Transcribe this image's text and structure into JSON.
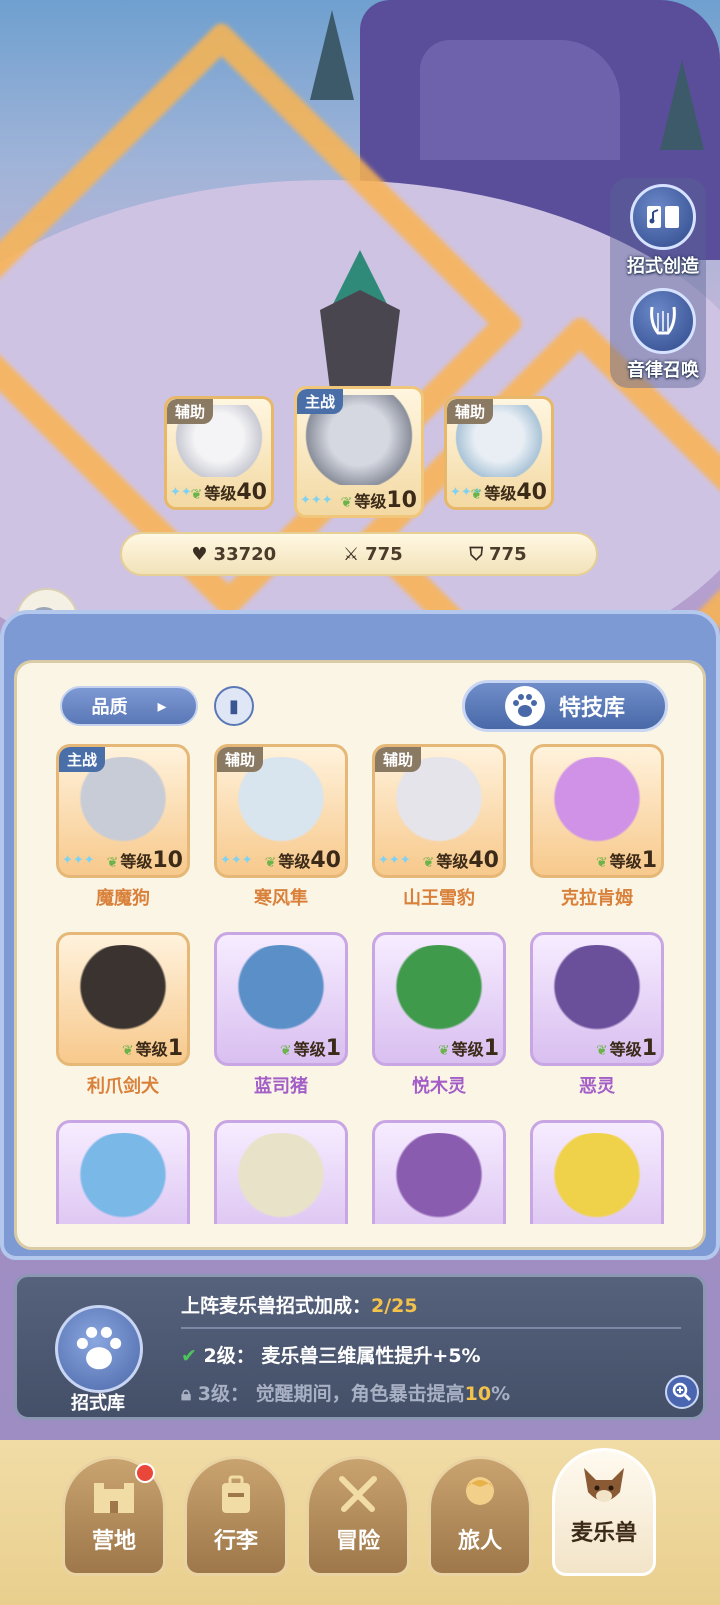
{
  "side_buttons": [
    {
      "label": "招式创造",
      "icon": "music-book-icon"
    },
    {
      "label": "音律召唤",
      "icon": "lyre-icon"
    }
  ],
  "team": [
    {
      "tag": "辅助",
      "level_label": "等级",
      "level": "40"
    },
    {
      "tag": "主战",
      "level_label": "等级",
      "level": "10"
    },
    {
      "tag": "辅助",
      "level_label": "等级",
      "level": "40"
    }
  ],
  "stats": {
    "hp": "33720",
    "attack": "775",
    "defense": "775"
  },
  "panel": {
    "filter_label": "品质",
    "skill_library_label": "特技库"
  },
  "pets": [
    {
      "name": "魔魔狗",
      "tag": "主战",
      "level_label": "等级",
      "level": "10",
      "rarity": "orange",
      "color": "#c8ccd6"
    },
    {
      "name": "寒风隼",
      "tag": "辅助",
      "level_label": "等级",
      "level": "40",
      "rarity": "orange",
      "color": "#d8e4ee"
    },
    {
      "name": "山王雪豹",
      "tag": "辅助",
      "level_label": "等级",
      "level": "40",
      "rarity": "orange",
      "color": "#e4e4ea"
    },
    {
      "name": "克拉肯姆",
      "tag": "",
      "level_label": "等级",
      "level": "1",
      "rarity": "orange",
      "color": "#cf92e6"
    },
    {
      "name": "利爪剑犬",
      "tag": "",
      "level_label": "等级",
      "level": "1",
      "rarity": "orange",
      "color": "#3a3330"
    },
    {
      "name": "蓝司猪",
      "tag": "",
      "level_label": "等级",
      "level": "1",
      "rarity": "purple",
      "color": "#5a8fc8"
    },
    {
      "name": "悦木灵",
      "tag": "",
      "level_label": "等级",
      "level": "1",
      "rarity": "purple",
      "color": "#3f9a4c"
    },
    {
      "name": "恶灵",
      "tag": "",
      "level_label": "等级",
      "level": "1",
      "rarity": "purple",
      "color": "#6a4f9a"
    },
    {
      "name": "",
      "tag": "",
      "level_label": "",
      "level": "",
      "rarity": "purple",
      "color": "#7ab8e8"
    },
    {
      "name": "",
      "tag": "",
      "level_label": "",
      "level": "",
      "rarity": "purple",
      "color": "#e8e2c8"
    },
    {
      "name": "",
      "tag": "",
      "level_label": "",
      "level": "",
      "rarity": "purple",
      "color": "#8a5cb0"
    },
    {
      "name": "",
      "tag": "",
      "level_label": "",
      "level": "",
      "rarity": "purple",
      "color": "#f0d24a"
    }
  ],
  "bonus": {
    "badge_label": "招式库",
    "title": "上阵麦乐兽招式加成：",
    "count": "2/25",
    "row1_level": "2级：",
    "row1_text": "麦乐兽三维属性提升+5%",
    "row2_level": "3级：",
    "row2_text": "觉醒期间，角色暴击提高",
    "row2_value": "10",
    "row2_unit": "%"
  },
  "nav": [
    {
      "label": "营地",
      "icon": "castle-icon",
      "badge": true
    },
    {
      "label": "行李",
      "icon": "backpack-icon",
      "badge": false
    },
    {
      "label": "冒险",
      "icon": "crossed-swords-icon",
      "badge": false
    },
    {
      "label": "旅人",
      "icon": "traveler-icon",
      "badge": false
    },
    {
      "label": "麦乐兽",
      "icon": "fox-face-icon",
      "badge": false
    }
  ],
  "colors": {
    "accent": "#5a78b6",
    "gold": "#f3c24a",
    "orange_name": "#d9813a",
    "purple_name": "#a35ec7"
  }
}
